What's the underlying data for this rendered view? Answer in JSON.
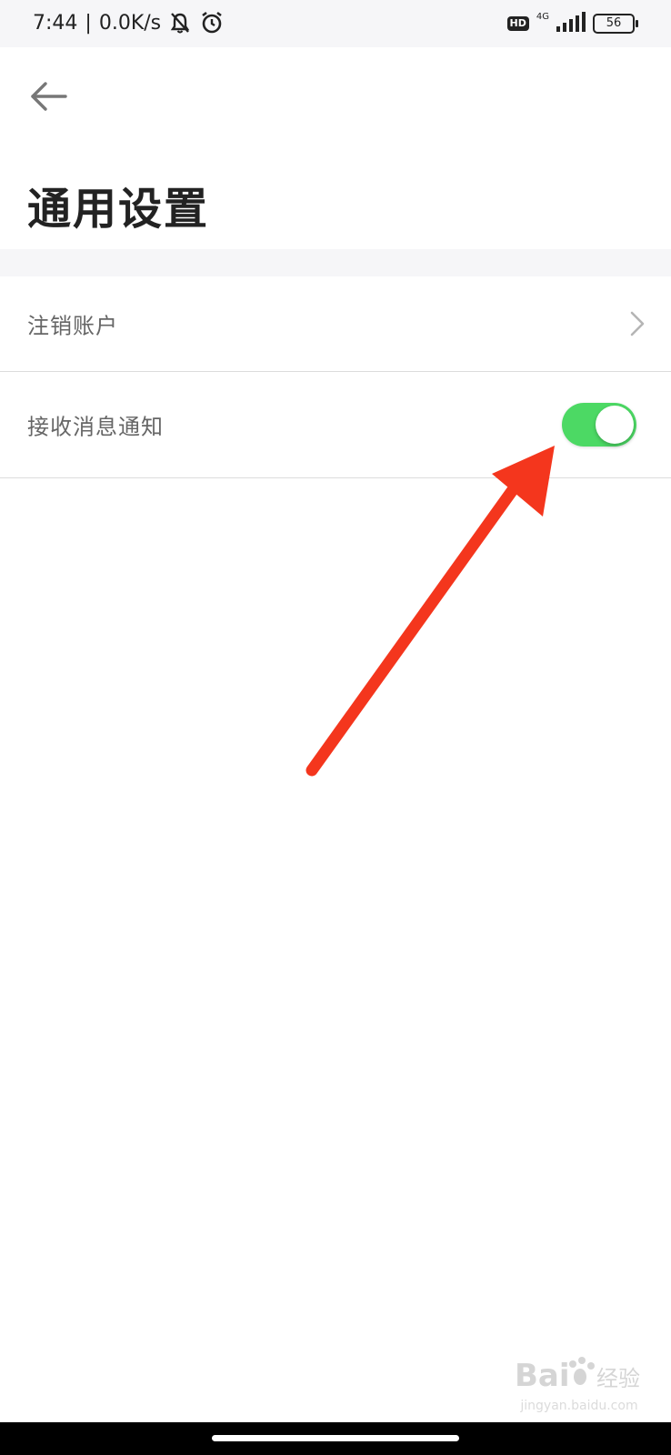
{
  "status_bar": {
    "time": "7:44",
    "network_speed": "0.0K/s",
    "separator": "|",
    "hd": "HD",
    "network_type": "4G",
    "battery": "56",
    "icons": [
      "mute-icon",
      "alarm-icon",
      "signal-icon",
      "battery-icon"
    ]
  },
  "header": {
    "back_icon": "back-arrow-icon",
    "title": "通用设置"
  },
  "settings": {
    "items": [
      {
        "label": "注销账户",
        "control": "chevron-right-icon"
      },
      {
        "label": "接收消息通知",
        "control": "toggle",
        "toggle_on": true
      }
    ]
  },
  "watermark": {
    "brand": "Baidu经验",
    "site": "jingyan.baidu.com"
  },
  "colors": {
    "toggle_on": "#4cd964",
    "annotation_arrow": "#f4361d",
    "band": "#f6f6f8",
    "title": "#222222",
    "label": "#666666"
  }
}
